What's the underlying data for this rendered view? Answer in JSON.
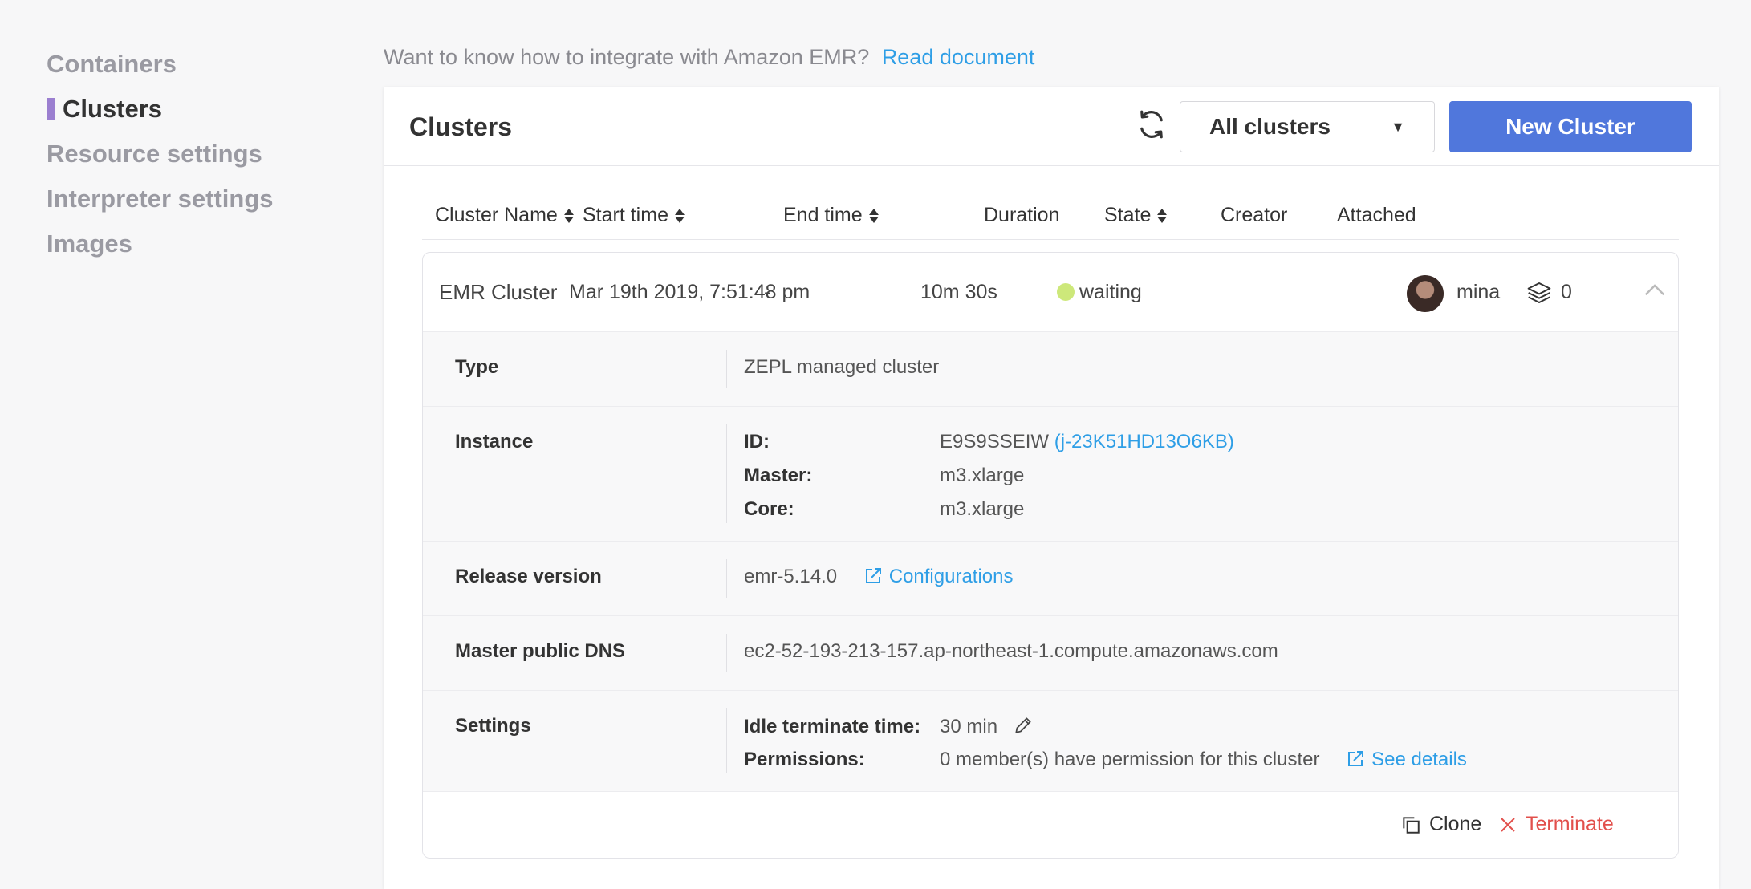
{
  "sidebar": {
    "items": [
      {
        "label": "Containers",
        "active": false
      },
      {
        "label": "Clusters",
        "active": true
      },
      {
        "label": "Resource settings",
        "active": false
      },
      {
        "label": "Interpreter settings",
        "active": false
      },
      {
        "label": "Images",
        "active": false
      }
    ]
  },
  "hint": {
    "text": "Want to know how to integrate with Amazon EMR?",
    "link": "Read document"
  },
  "panel": {
    "title": "Clusters",
    "refresh_icon": "refresh-icon",
    "filter": {
      "selected": "All clusters"
    },
    "new_button": "New Cluster"
  },
  "table": {
    "columns": [
      "Cluster Name",
      "Start time",
      "End time",
      "Duration",
      "State",
      "Creator",
      "Attached"
    ],
    "row": {
      "name": "EMR Cluster",
      "start": "Mar 19th 2019, 7:51:48 pm",
      "end": "-",
      "duration": "10m 30s",
      "state": "waiting",
      "state_color": "#cde87a",
      "creator": "mina",
      "attached": "0"
    }
  },
  "details": {
    "type": {
      "label": "Type",
      "value": "ZEPL managed cluster"
    },
    "instance": {
      "label": "Instance",
      "id_key": "ID:",
      "id_value": "E9S9SSEIW",
      "id_link": "(j-23K51HD13O6KB)",
      "master_key": "Master:",
      "master_value": "m3.xlarge",
      "core_key": "Core:",
      "core_value": "m3.xlarge"
    },
    "release": {
      "label": "Release version",
      "value": "emr-5.14.0",
      "link": "Configurations"
    },
    "dns": {
      "label": "Master public DNS",
      "value": "ec2-52-193-213-157.ap-northeast-1.compute.amazonaws.com"
    },
    "settings": {
      "label": "Settings",
      "idle_key": "Idle terminate time:",
      "idle_value": "30 min",
      "perm_key": "Permissions:",
      "perm_value": "0 member(s) have permission for this cluster",
      "perm_link": "See details"
    }
  },
  "actions": {
    "clone": "Clone",
    "terminate": "Terminate"
  },
  "colors": {
    "accent": "#5077dc",
    "link": "#2e9ee6",
    "danger": "#e2504c",
    "sidebar_marker": "#9b7fd0"
  }
}
